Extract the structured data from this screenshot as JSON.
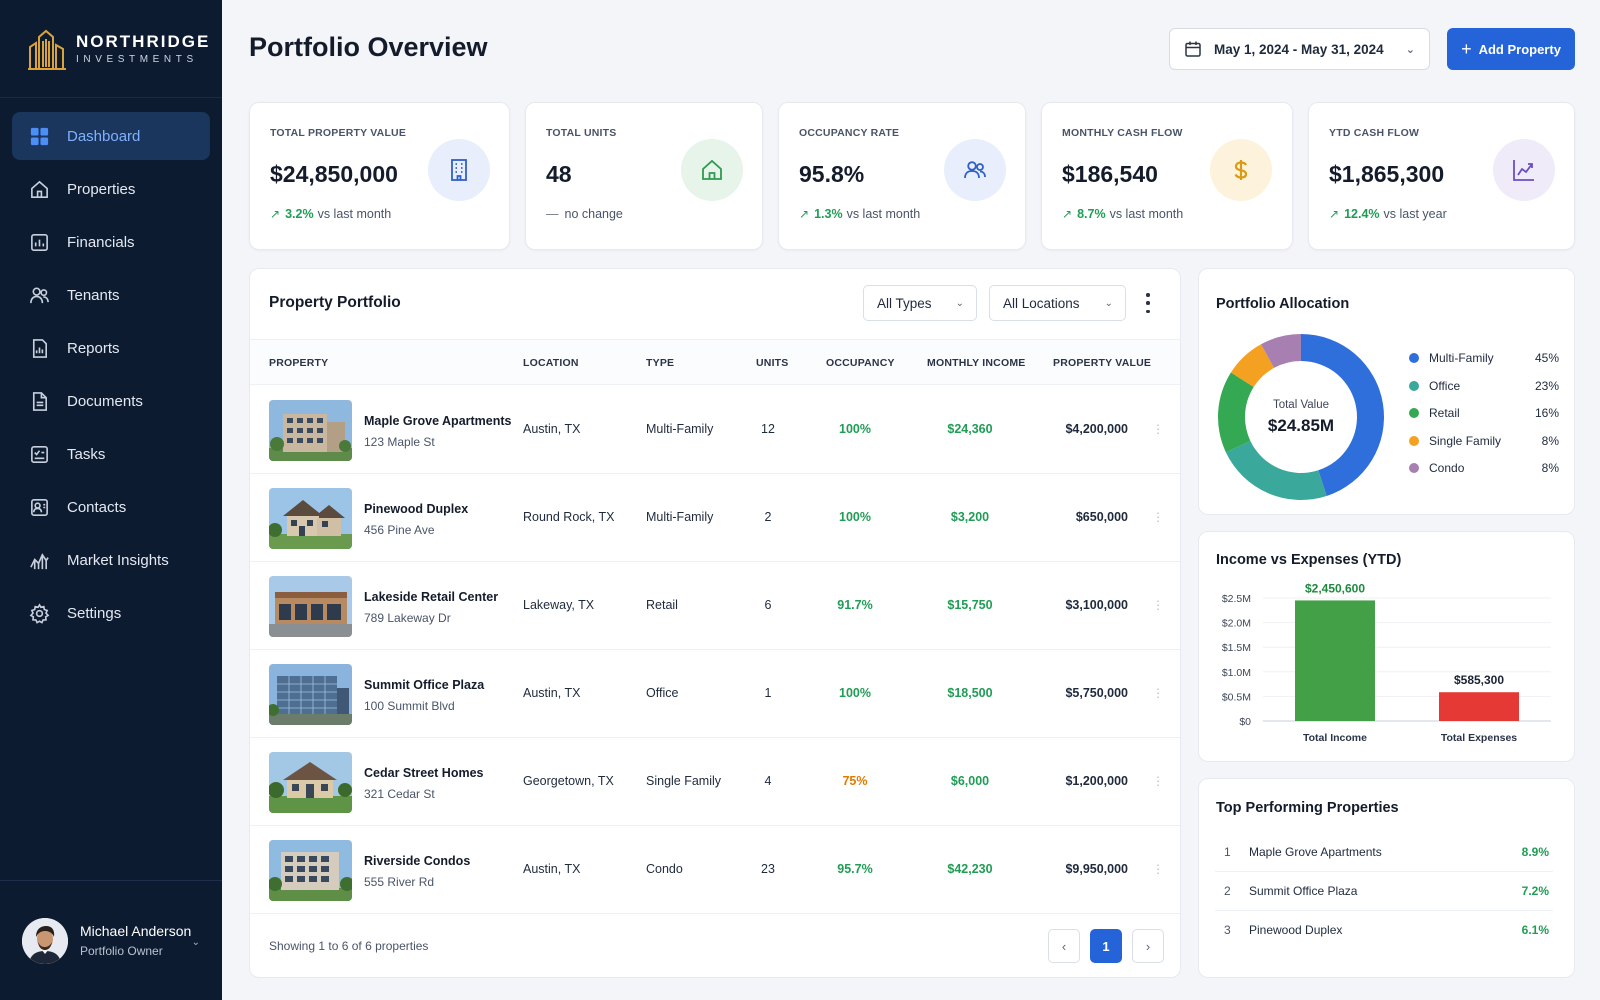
{
  "brand": {
    "name": "NORTHRIDGE",
    "sub": "INVESTMENTS"
  },
  "sidebar": {
    "items": [
      {
        "label": "Dashboard",
        "icon": "grid-icon",
        "active": true
      },
      {
        "label": "Properties",
        "icon": "home-icon"
      },
      {
        "label": "Financials",
        "icon": "financials-icon"
      },
      {
        "label": "Tenants",
        "icon": "users-icon"
      },
      {
        "label": "Reports",
        "icon": "report-icon"
      },
      {
        "label": "Documents",
        "icon": "document-icon"
      },
      {
        "label": "Tasks",
        "icon": "tasks-icon"
      },
      {
        "label": "Contacts",
        "icon": "contacts-icon"
      },
      {
        "label": "Market Insights",
        "icon": "market-icon"
      },
      {
        "label": "Settings",
        "icon": "gear-icon"
      }
    ]
  },
  "user": {
    "name": "Michael Anderson",
    "role": "Portfolio Owner"
  },
  "header": {
    "title": "Portfolio Overview",
    "date_range": "May 1, 2024 - May 31, 2024",
    "add_label": "Add Property"
  },
  "kpis": [
    {
      "label": "TOTAL PROPERTY VALUE",
      "value": "$24,850,000",
      "change": "3.2%",
      "change_text": "vs last month",
      "icon": "building-icon",
      "trend": "up"
    },
    {
      "label": "TOTAL UNITS",
      "value": "48",
      "change": "",
      "change_text": "no change",
      "icon": "home-icon",
      "trend": "flat"
    },
    {
      "label": "OCCUPANCY RATE",
      "value": "95.8%",
      "change": "1.3%",
      "change_text": "vs last month",
      "icon": "users-icon",
      "trend": "up"
    },
    {
      "label": "MONTHLY CASH FLOW",
      "value": "$186,540",
      "change": "8.7%",
      "change_text": "vs last month",
      "icon": "dollar-icon",
      "trend": "up"
    },
    {
      "label": "YTD CASH FLOW",
      "value": "$1,865,300",
      "change": "12.4%",
      "change_text": "vs last year",
      "icon": "chart-icon",
      "trend": "up"
    }
  ],
  "portfolio": {
    "title": "Property Portfolio",
    "filter_type": "All Types",
    "filter_location": "All Locations",
    "columns": [
      "PROPERTY",
      "LOCATION",
      "TYPE",
      "UNITS",
      "OCCUPANCY",
      "MONTHLY INCOME",
      "PROPERTY VALUE"
    ],
    "rows": [
      {
        "name": "Maple Grove Apartments",
        "address": "123 Maple St",
        "location": "Austin, TX",
        "type": "Multi-Family",
        "units": "12",
        "occupancy": "100%",
        "income": "$24,360",
        "value": "$4,200,000"
      },
      {
        "name": "Pinewood Duplex",
        "address": "456 Pine Ave",
        "location": "Round Rock, TX",
        "type": "Multi-Family",
        "units": "2",
        "occupancy": "100%",
        "income": "$3,200",
        "value": "$650,000"
      },
      {
        "name": "Lakeside Retail Center",
        "address": "789 Lakeway Dr",
        "location": "Lakeway, TX",
        "type": "Retail",
        "units": "6",
        "occupancy": "91.7%",
        "income": "$15,750",
        "value": "$3,100,000"
      },
      {
        "name": "Summit Office Plaza",
        "address": "100 Summit Blvd",
        "location": "Austin, TX",
        "type": "Office",
        "units": "1",
        "occupancy": "100%",
        "income": "$18,500",
        "value": "$5,750,000"
      },
      {
        "name": "Cedar Street Homes",
        "address": "321 Cedar St",
        "location": "Georgetown, TX",
        "type": "Single Family",
        "units": "4",
        "occupancy": "75%",
        "income": "$6,000",
        "value": "$1,200,000"
      },
      {
        "name": "Riverside Condos",
        "address": "555 River Rd",
        "location": "Austin, TX",
        "type": "Condo",
        "units": "23",
        "occupancy": "95.7%",
        "income": "$42,230",
        "value": "$9,950,000"
      }
    ],
    "footer": "Showing 1 to 6 of 6 properties",
    "page": "1"
  },
  "allocation": {
    "title": "Portfolio Allocation",
    "center_label": "Total Value",
    "center_value": "$24.85M",
    "chart_data": {
      "type": "pie",
      "categories": [
        "Multi-Family",
        "Office",
        "Retail",
        "Single Family",
        "Condo"
      ],
      "values": [
        45,
        23,
        16,
        8,
        8
      ],
      "labels": [
        "45%",
        "23%",
        "16%",
        "8%",
        "8%"
      ],
      "colors": [
        "#2f6fdc",
        "#3aa89b",
        "#34a853",
        "#f4a020",
        "#a77fb0"
      ]
    }
  },
  "income_expenses": {
    "title": "Income vs Expenses (YTD)",
    "chart_data": {
      "type": "bar",
      "categories": [
        "Total Income",
        "Total Expenses"
      ],
      "values": [
        2450600,
        585300
      ],
      "value_labels": [
        "$2,450,600",
        "$585,300"
      ],
      "colors": [
        "#43a047",
        "#e53935"
      ],
      "ylim": [
        0,
        2500000
      ],
      "yticks": [
        "$0",
        "$0.5M",
        "$1.0M",
        "$1.5M",
        "$2.0M",
        "$2.5M"
      ]
    }
  },
  "top_performing": {
    "title": "Top Performing Properties",
    "items": [
      {
        "rank": "1",
        "name": "Maple Grove Apartments",
        "value": "8.9%"
      },
      {
        "rank": "2",
        "name": "Summit Office Plaza",
        "value": "7.2%"
      },
      {
        "rank": "3",
        "name": "Pinewood Duplex",
        "value": "6.1%"
      }
    ]
  }
}
